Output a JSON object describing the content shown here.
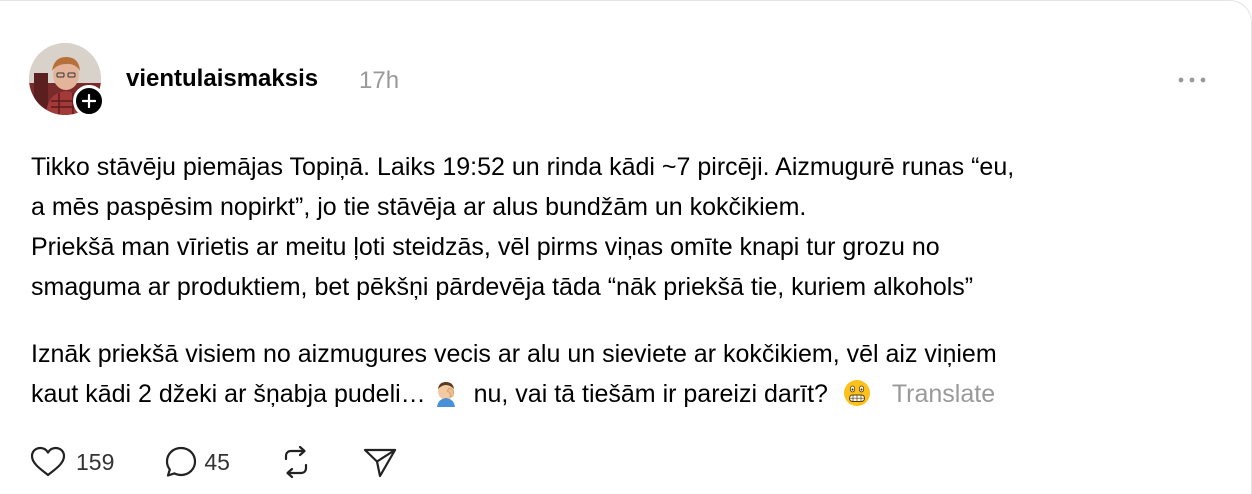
{
  "post": {
    "username": "vientulaismaksis",
    "time": "17h",
    "paragraph1": [
      "Tikko stāvēju piemājas Topiņā. Laiks 19:52 un rinda kādi ~7 pircēji. Aizmugurē runas “eu,",
      "a mēs paspēsim nopirkt”, jo tie stāvēja ar alus bundžām un kokčikiem.",
      "Priekšā man vīrietis ar meitu ļoti steidzās, vēl pirms viņas omīte knapi tur grozu no",
      "smaguma ar produktiem, bet pēkšņi pārdevēja tāda “nāk priekšā tie, kuriem alkohols”"
    ],
    "paragraph2": {
      "line1": "Iznāk priekšā visiem no aizmugures vecis ar alu un sieviete ar kokčikiem, vēl aiz viņiem",
      "line2_a": "kaut kādi 2 džeki ar šņabja pudeli…",
      "line2_b": "nu, vai tā tiešām ir pareizi darīt?",
      "translate": "Translate"
    },
    "stats": {
      "likes": "159",
      "replies": "45"
    }
  },
  "icons": {
    "follow": "plus-icon",
    "more": "more-horizontal-icon",
    "like": "heart-icon",
    "reply": "speech-bubble-icon",
    "repost": "repost-icon",
    "share": "send-icon",
    "emoji1": "man-facepalming-emoji",
    "emoji2": "grimacing-face-emoji"
  },
  "colors": {
    "text": "#000000",
    "muted": "#999999",
    "border": "#e5e5e5"
  }
}
